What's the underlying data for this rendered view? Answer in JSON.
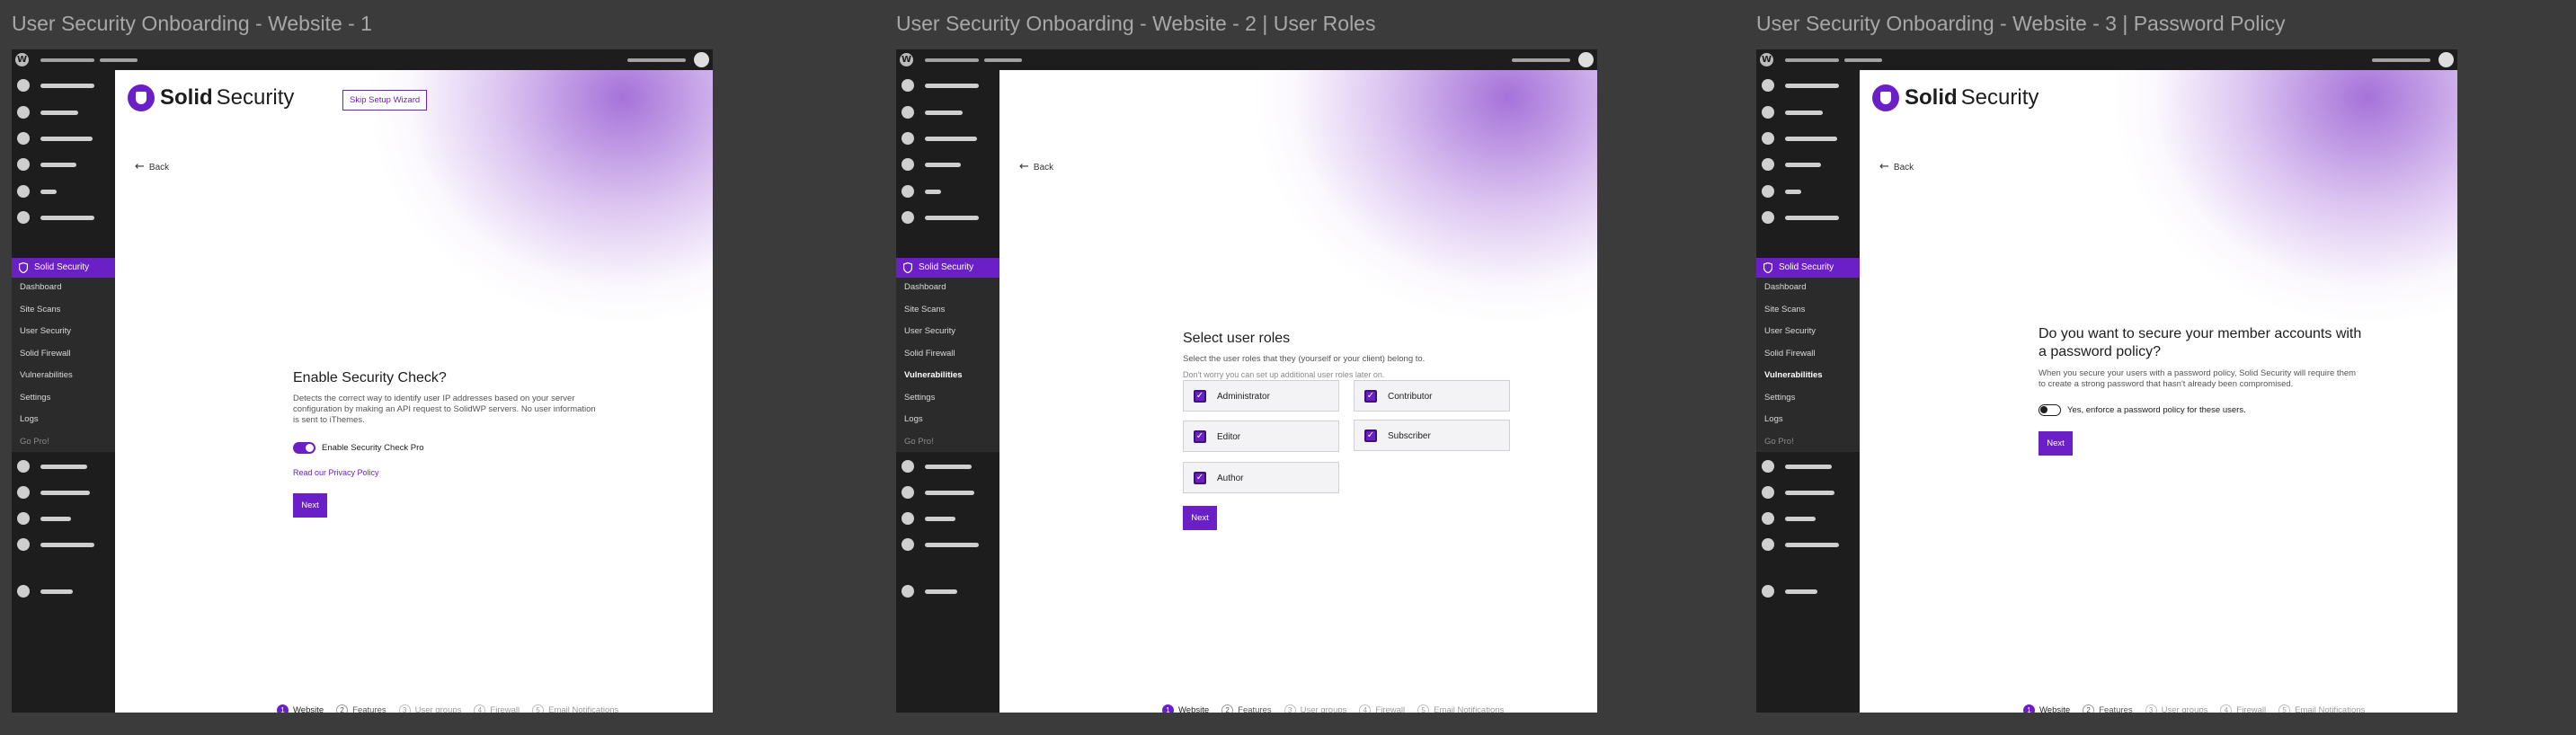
{
  "frames": [
    {
      "title": "User Security Onboarding - Website - 1",
      "skip_label": "Skip Setup Wizard",
      "back_label": "Back",
      "heading": "Enable Security Check?",
      "description": "Detects the correct way to identify user IP addresses based on your server configuration by making an API request to SolidWP servers. No user information is sent to iThemes.",
      "toggle_label": "Enable Security Check Pro",
      "toggle_on": true,
      "privacy_link": "Read our Privacy Policy",
      "next_label": "Next"
    },
    {
      "title": "User Security Onboarding - Website - 2 | User Roles",
      "back_label": "Back",
      "heading": "Select user roles",
      "description": "Select the user roles that they (yourself or your client) belong to.",
      "note": "Don't worry you can set up additional user roles later on.",
      "roles": [
        "Administrator",
        "Contributor",
        "Editor",
        "Subscriber",
        "Author"
      ],
      "next_label": "Next"
    },
    {
      "title": "User Security Onboarding - Website - 3 | Password Policy",
      "back_label": "Back",
      "heading": "Do you want to secure your member accounts with a password policy?",
      "description": "When you secure your users with a password policy, Solid Security will require them to create a strong password that hasn't already been compromised.",
      "toggle_label": "Yes, enforce a password policy for these users.",
      "toggle_on": false,
      "next_label": "Next"
    }
  ],
  "brand": {
    "name_bold": "Solid",
    "name_rest": "Security",
    "accent": "#6b1fc7"
  },
  "sidebar": {
    "active_label": "Solid Security",
    "items": [
      "Dashboard",
      "Site Scans",
      "User Security",
      "Solid Firewall",
      "Vulnerabilities",
      "Settings",
      "Logs",
      "Go Pro!"
    ]
  },
  "stepper": [
    {
      "num": "1",
      "label": "Website"
    },
    {
      "num": "2",
      "label": "Features"
    },
    {
      "num": "3",
      "label": "User groups"
    },
    {
      "num": "4",
      "label": "Firewall"
    },
    {
      "num": "5",
      "label": "Email Notifications"
    }
  ],
  "icons": {
    "wp": "wordpress-icon",
    "shield": "shield-icon",
    "back": "arrow-left-icon",
    "check": "checkmark-icon"
  }
}
